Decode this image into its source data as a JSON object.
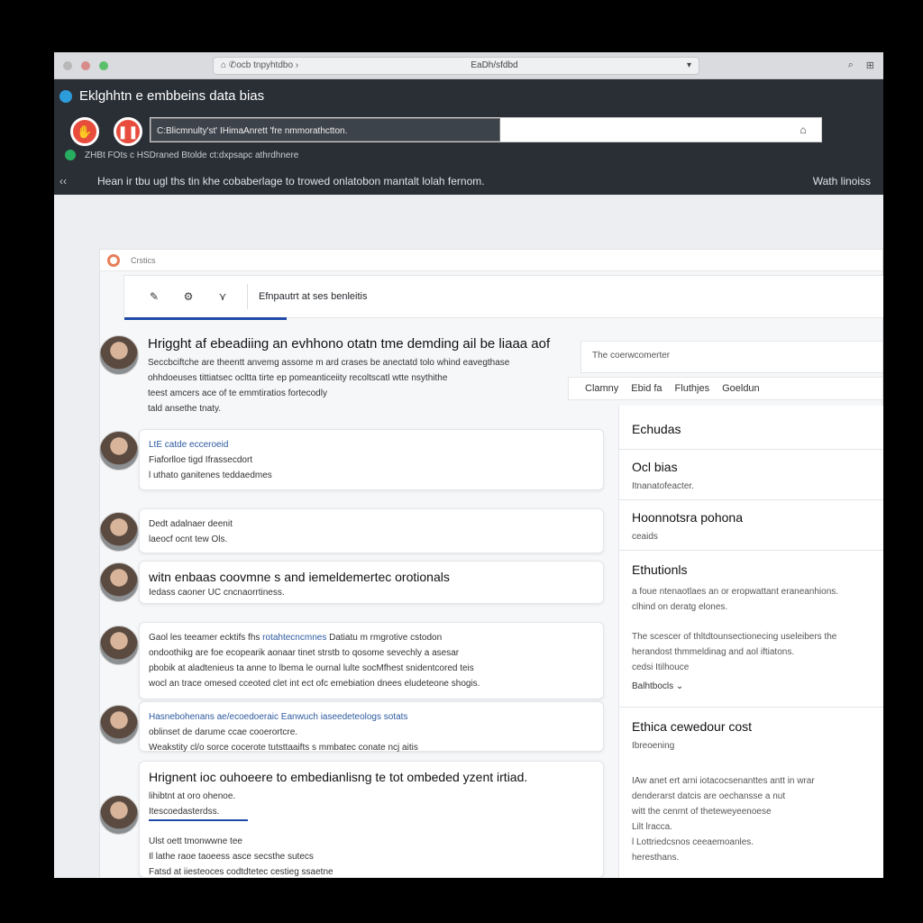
{
  "browser": {
    "address_left": "⌂ ✆ocb tnpyhtdbo ›",
    "address_center": "EaDh/sfdbd",
    "right_icons": [
      "⌕",
      "⊞"
    ]
  },
  "header": {
    "title": "Eklghhtn e embbeins data bias",
    "search_value": "C:Blicmnulty'st' IHimaAnrett 'fre nmmorathctton.",
    "search_symbol": "⌂",
    "sub_status": "ZHBt FOts c HSDraned Btolde ct:dxpsapc athrdhnere",
    "description": "Hean ir tbu ugl ths tin khe cobaberlage to trowed onlatobon mantalt lolah fernom.",
    "back_label": "‹‹",
    "right_link": "Wath linoiss"
  },
  "panel": {
    "top_label": "Crstics",
    "toolbar_label": "Efnpautrt at ses benleitis"
  },
  "feed": {
    "post1": {
      "title": "Hrigght af ebeadiing an evhhono otatn tme demding ail be liaaa aof",
      "line1": "Seccbciftche are theentt anvemg assome m ard crases be anectatd tolo whind eavegthase",
      "line2": "ohhdoeuses tittiatsec ocltta tirte ep pomeanticeiity recoltscatl wtte nsythithe",
      "line3": "teest amcers ace of te emmtiratios fortecodly",
      "line4": "tald ansethe tnaty."
    },
    "post2": {
      "title": "LtE catde ecceroeid",
      "line1": "Fiaforlloe tigd Ifrassecdort",
      "line2": "l uthato ganitenes teddaedmes"
    },
    "post3": {
      "title": "Dedt adalnaer deenit",
      "line1": "laeocf ocnt tew Ols."
    },
    "post4": {
      "title": "witn enbaas coovmne s and iemeldemertec orotionals",
      "line1": "Iedass caoner UC cncnaorrtiness."
    },
    "post5": {
      "lead": "Gaol les teeamer ecktifs fhs",
      "link": "rotahtecncmnes",
      "rest": "Datiatu m rmgrotive cstodon",
      "line1": "ondoothikg are foe ecopearik aonaar tinet strstb to qosome sevechly a asesar",
      "line2": "pbobik at aladtenieus ta anne to lbema le ournal lulte socMfhest snidentcored teis",
      "line3": "wocl an trace omesed cceoted clet int ect ofc emebiation dnees eludeteone shogis."
    },
    "post6": {
      "title": "Hasnebohenans ae/ecoedoeraic Eanwuch iaseedeteologs sotats",
      "line1": "oblinset de darume ccae cooerortcre.",
      "line2": "Weakstity cl/o sorce cocerote tutsttaaifts s mmbatec conate ncj aitis"
    },
    "post7": {
      "title": "Hrignent ioc ouhoeere to embedianlisng te tot ombeded yzent irtiad.",
      "line1": "lihibtnt at oro ohenoe.",
      "line2": "Itescoedasterdss."
    },
    "post8": {
      "title": "Ulst oett tmonwwne tee",
      "line1": "Il lathe raoe taoeess asce secsthe sutecs",
      "line2": "Fatsd at iiesteoces codtdtetec cestieg ssaetne"
    }
  },
  "right": {
    "search_hint": "The coerwcomerter",
    "tabs": [
      "Clamny",
      "Ebid  fa",
      "Fluthjes",
      "Goeldun"
    ],
    "sections": [
      {
        "heading": "Echudas",
        "sub": ""
      },
      {
        "heading": "Ocl bias",
        "sub": "Itnanatofeacter."
      },
      {
        "heading": "Hoonnotsra pohona",
        "sub": "ceaids"
      },
      {
        "heading": "Ethutionls",
        "sub": "a foue ntenaotlaes an or eropwattant eraneanhions.\nclhind on deratg elones."
      },
      {
        "heading": "",
        "sub": "The scescer of thltdtounsectionecing useleibers the\nherandost thmmeldinag and aol iftiatons.\ncedsi Itilhouce"
      },
      {
        "heading": "Balhtbocls ⌄",
        "sub": ""
      },
      {
        "heading": "Ethica cewedour cost",
        "sub": "Ibreoening"
      },
      {
        "heading": "",
        "sub": "IAw anet ert arni iotacocsenanttes antt in wrar\ndenderarst datcis are oechansse a nut\nwitt the cenrnt of theteweyeenoese\nLilt lracca.\nl Lottriedcsnos ceeaemoanles.\nheresthans."
      }
    ]
  },
  "colors": {
    "header_bg": "#2a2f36",
    "accent": "#1f4aa8",
    "red": "#e74c3c",
    "green": "#27ae60"
  }
}
